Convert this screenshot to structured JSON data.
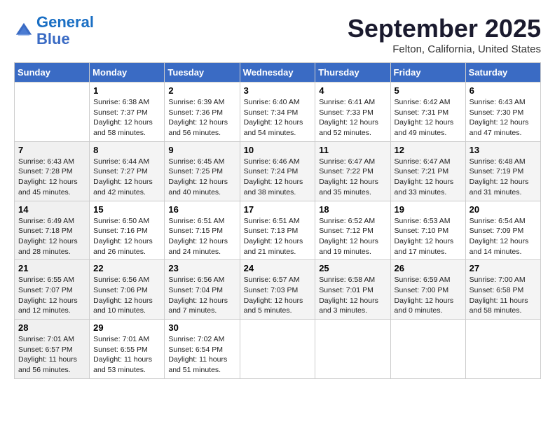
{
  "header": {
    "logo_line1": "General",
    "logo_line2": "Blue",
    "month": "September 2025",
    "location": "Felton, California, United States"
  },
  "weekdays": [
    "Sunday",
    "Monday",
    "Tuesday",
    "Wednesday",
    "Thursday",
    "Friday",
    "Saturday"
  ],
  "weeks": [
    [
      {
        "num": "",
        "sunrise": "",
        "sunset": "",
        "daylight": ""
      },
      {
        "num": "1",
        "sunrise": "Sunrise: 6:38 AM",
        "sunset": "Sunset: 7:37 PM",
        "daylight": "Daylight: 12 hours and 58 minutes."
      },
      {
        "num": "2",
        "sunrise": "Sunrise: 6:39 AM",
        "sunset": "Sunset: 7:36 PM",
        "daylight": "Daylight: 12 hours and 56 minutes."
      },
      {
        "num": "3",
        "sunrise": "Sunrise: 6:40 AM",
        "sunset": "Sunset: 7:34 PM",
        "daylight": "Daylight: 12 hours and 54 minutes."
      },
      {
        "num": "4",
        "sunrise": "Sunrise: 6:41 AM",
        "sunset": "Sunset: 7:33 PM",
        "daylight": "Daylight: 12 hours and 52 minutes."
      },
      {
        "num": "5",
        "sunrise": "Sunrise: 6:42 AM",
        "sunset": "Sunset: 7:31 PM",
        "daylight": "Daylight: 12 hours and 49 minutes."
      },
      {
        "num": "6",
        "sunrise": "Sunrise: 6:43 AM",
        "sunset": "Sunset: 7:30 PM",
        "daylight": "Daylight: 12 hours and 47 minutes."
      }
    ],
    [
      {
        "num": "7",
        "sunrise": "Sunrise: 6:43 AM",
        "sunset": "Sunset: 7:28 PM",
        "daylight": "Daylight: 12 hours and 45 minutes."
      },
      {
        "num": "8",
        "sunrise": "Sunrise: 6:44 AM",
        "sunset": "Sunset: 7:27 PM",
        "daylight": "Daylight: 12 hours and 42 minutes."
      },
      {
        "num": "9",
        "sunrise": "Sunrise: 6:45 AM",
        "sunset": "Sunset: 7:25 PM",
        "daylight": "Daylight: 12 hours and 40 minutes."
      },
      {
        "num": "10",
        "sunrise": "Sunrise: 6:46 AM",
        "sunset": "Sunset: 7:24 PM",
        "daylight": "Daylight: 12 hours and 38 minutes."
      },
      {
        "num": "11",
        "sunrise": "Sunrise: 6:47 AM",
        "sunset": "Sunset: 7:22 PM",
        "daylight": "Daylight: 12 hours and 35 minutes."
      },
      {
        "num": "12",
        "sunrise": "Sunrise: 6:47 AM",
        "sunset": "Sunset: 7:21 PM",
        "daylight": "Daylight: 12 hours and 33 minutes."
      },
      {
        "num": "13",
        "sunrise": "Sunrise: 6:48 AM",
        "sunset": "Sunset: 7:19 PM",
        "daylight": "Daylight: 12 hours and 31 minutes."
      }
    ],
    [
      {
        "num": "14",
        "sunrise": "Sunrise: 6:49 AM",
        "sunset": "Sunset: 7:18 PM",
        "daylight": "Daylight: 12 hours and 28 minutes."
      },
      {
        "num": "15",
        "sunrise": "Sunrise: 6:50 AM",
        "sunset": "Sunset: 7:16 PM",
        "daylight": "Daylight: 12 hours and 26 minutes."
      },
      {
        "num": "16",
        "sunrise": "Sunrise: 6:51 AM",
        "sunset": "Sunset: 7:15 PM",
        "daylight": "Daylight: 12 hours and 24 minutes."
      },
      {
        "num": "17",
        "sunrise": "Sunrise: 6:51 AM",
        "sunset": "Sunset: 7:13 PM",
        "daylight": "Daylight: 12 hours and 21 minutes."
      },
      {
        "num": "18",
        "sunrise": "Sunrise: 6:52 AM",
        "sunset": "Sunset: 7:12 PM",
        "daylight": "Daylight: 12 hours and 19 minutes."
      },
      {
        "num": "19",
        "sunrise": "Sunrise: 6:53 AM",
        "sunset": "Sunset: 7:10 PM",
        "daylight": "Daylight: 12 hours and 17 minutes."
      },
      {
        "num": "20",
        "sunrise": "Sunrise: 6:54 AM",
        "sunset": "Sunset: 7:09 PM",
        "daylight": "Daylight: 12 hours and 14 minutes."
      }
    ],
    [
      {
        "num": "21",
        "sunrise": "Sunrise: 6:55 AM",
        "sunset": "Sunset: 7:07 PM",
        "daylight": "Daylight: 12 hours and 12 minutes."
      },
      {
        "num": "22",
        "sunrise": "Sunrise: 6:56 AM",
        "sunset": "Sunset: 7:06 PM",
        "daylight": "Daylight: 12 hours and 10 minutes."
      },
      {
        "num": "23",
        "sunrise": "Sunrise: 6:56 AM",
        "sunset": "Sunset: 7:04 PM",
        "daylight": "Daylight: 12 hours and 7 minutes."
      },
      {
        "num": "24",
        "sunrise": "Sunrise: 6:57 AM",
        "sunset": "Sunset: 7:03 PM",
        "daylight": "Daylight: 12 hours and 5 minutes."
      },
      {
        "num": "25",
        "sunrise": "Sunrise: 6:58 AM",
        "sunset": "Sunset: 7:01 PM",
        "daylight": "Daylight: 12 hours and 3 minutes."
      },
      {
        "num": "26",
        "sunrise": "Sunrise: 6:59 AM",
        "sunset": "Sunset: 7:00 PM",
        "daylight": "Daylight: 12 hours and 0 minutes."
      },
      {
        "num": "27",
        "sunrise": "Sunrise: 7:00 AM",
        "sunset": "Sunset: 6:58 PM",
        "daylight": "Daylight: 11 hours and 58 minutes."
      }
    ],
    [
      {
        "num": "28",
        "sunrise": "Sunrise: 7:01 AM",
        "sunset": "Sunset: 6:57 PM",
        "daylight": "Daylight: 11 hours and 56 minutes."
      },
      {
        "num": "29",
        "sunrise": "Sunrise: 7:01 AM",
        "sunset": "Sunset: 6:55 PM",
        "daylight": "Daylight: 11 hours and 53 minutes."
      },
      {
        "num": "30",
        "sunrise": "Sunrise: 7:02 AM",
        "sunset": "Sunset: 6:54 PM",
        "daylight": "Daylight: 11 hours and 51 minutes."
      },
      {
        "num": "",
        "sunrise": "",
        "sunset": "",
        "daylight": ""
      },
      {
        "num": "",
        "sunrise": "",
        "sunset": "",
        "daylight": ""
      },
      {
        "num": "",
        "sunrise": "",
        "sunset": "",
        "daylight": ""
      },
      {
        "num": "",
        "sunrise": "",
        "sunset": "",
        "daylight": ""
      }
    ]
  ]
}
